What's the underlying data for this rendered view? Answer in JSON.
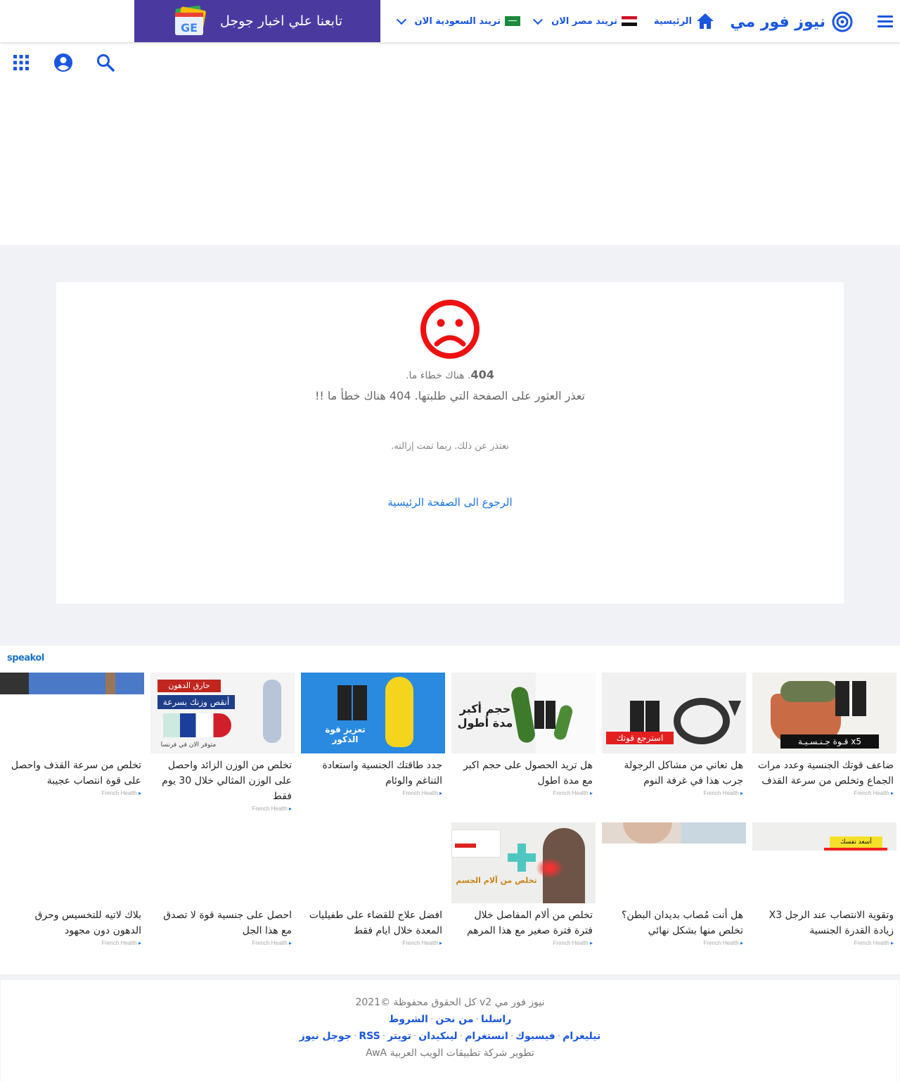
{
  "header": {
    "logo_text": "نيوز فور مي",
    "nav_home": "الرئيسية",
    "nav_egypt": "تريند مصر الان",
    "nav_saudi": "تريند السعودية الان",
    "gnews_text": "تابعنا علي اخبار جوجل"
  },
  "error": {
    "code": "404",
    "short_msg": ". هناك خطاء ما.",
    "long_msg": "تعذر العثور على الصفحة التي طلبتها. 404 هناك خطأ ما !!",
    "apology": "نعتذر عن ذلك. ربما تمت إزالته.",
    "back_link": " الرجوع الى الصفحة الرئيسية"
  },
  "speakol": {
    "logo": "speakol",
    "source": "French Health",
    "ads": [
      {
        "title": "ضاعف قوتك الجنسية وعدد مرات الجماع وتخلص من سرعة القذف",
        "img_caption": "x5 قـوة جـنـسـيـة"
      },
      {
        "title": "هل تعاني من مشاكل الرجولة جرب هذا في غرفة النوم",
        "img_caption": "استرجع قوتك"
      },
      {
        "title": "هل تريد الحصول على حجم اكبر مع مدة اطول",
        "img_caption": "حجم أكبر مدة أطول"
      },
      {
        "title": "جدد طاقتك الجنسية واستعادة التناغم والوئام",
        "img_caption": "تعزيز قوة الذكور"
      },
      {
        "title": "تخلص من الوزن الزائد واحصل على الوزن المثالي خلال 30 يوم فقط",
        "img_caption_1": "حارق الدهون",
        "img_caption_2": "أنقص وزنك بسرعة",
        "img_caption_3": "متوفر الان في فرنسا"
      },
      {
        "title": "تخلص من سرعة القذف واحصل على قوة انتصاب عجيبة"
      },
      {
        "title": "وتقوية الانتصاب عند الرجل X3 زيادة القدرة الجنسية",
        "img_caption": "أسعد نفسك"
      },
      {
        "title": "هل أنت مُصاب بديدان البطن؟ تخلص منها بشكل نهائي"
      },
      {
        "title": "تخلص من ألام المفاصل خلال فترة فترة صغير مع هذا المرهم",
        "img_caption": "تخلص من آلام الجسم"
      },
      {
        "title": "افضل علاج للقضاء على طفيليات المعدة خلال ايام فقط"
      },
      {
        "title": "احصل على جنسية قوة لا تصدق مع هذا الجل"
      },
      {
        "title": "بلاك لاتيه للتخسيس وحرق الدهون دون مجهود"
      }
    ]
  },
  "footer": {
    "copyright": "نيوز فور مي v2 كل الحقوق محفوظة ©2021",
    "links": [
      "راسلنا",
      "من نحن",
      "الشروط"
    ],
    "social": [
      "تيليغرام",
      "فيسبوك",
      "انستغرام",
      "لينكيدان",
      "تويتر",
      "RSS",
      "جوجل نيوز"
    ],
    "developer": "تطوير شركة تطبيقات الويب العربية AwA"
  }
}
